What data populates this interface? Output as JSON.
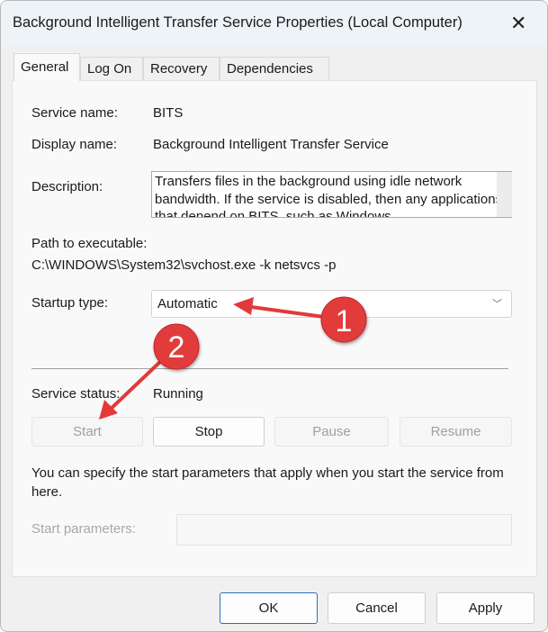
{
  "window": {
    "title": "Background Intelligent Transfer Service Properties (Local Computer)",
    "close_icon": "close-icon"
  },
  "tabs": [
    {
      "label": "General",
      "active": true
    },
    {
      "label": "Log On"
    },
    {
      "label": "Recovery"
    },
    {
      "label": "Dependencies"
    }
  ],
  "general": {
    "service_name_label": "Service name:",
    "service_name": "BITS",
    "display_name_label": "Display name:",
    "display_name": "Background Intelligent Transfer Service",
    "description_label": "Description:",
    "description": "Transfers files in the background using idle network bandwidth. If the service is disabled, then any applications that depend on BITS, such as Windows",
    "path_label": "Path to executable:",
    "path": "C:\\WINDOWS\\System32\\svchost.exe -k netsvcs -p",
    "startup_type_label": "Startup type:",
    "startup_type": "Automatic",
    "status_label": "Service status:",
    "status": "Running",
    "buttons": {
      "start": "Start",
      "stop": "Stop",
      "pause": "Pause",
      "resume": "Resume"
    },
    "hint": "You can specify the start parameters that apply when you start the service from here.",
    "start_params_label": "Start parameters:",
    "start_params_value": ""
  },
  "footer": {
    "ok": "OK",
    "cancel": "Cancel",
    "apply": "Apply"
  },
  "annotations": [
    {
      "number": "1"
    },
    {
      "number": "2"
    }
  ],
  "colors": {
    "annotation": "#e23a3a",
    "accent": "#2f6fbf"
  }
}
